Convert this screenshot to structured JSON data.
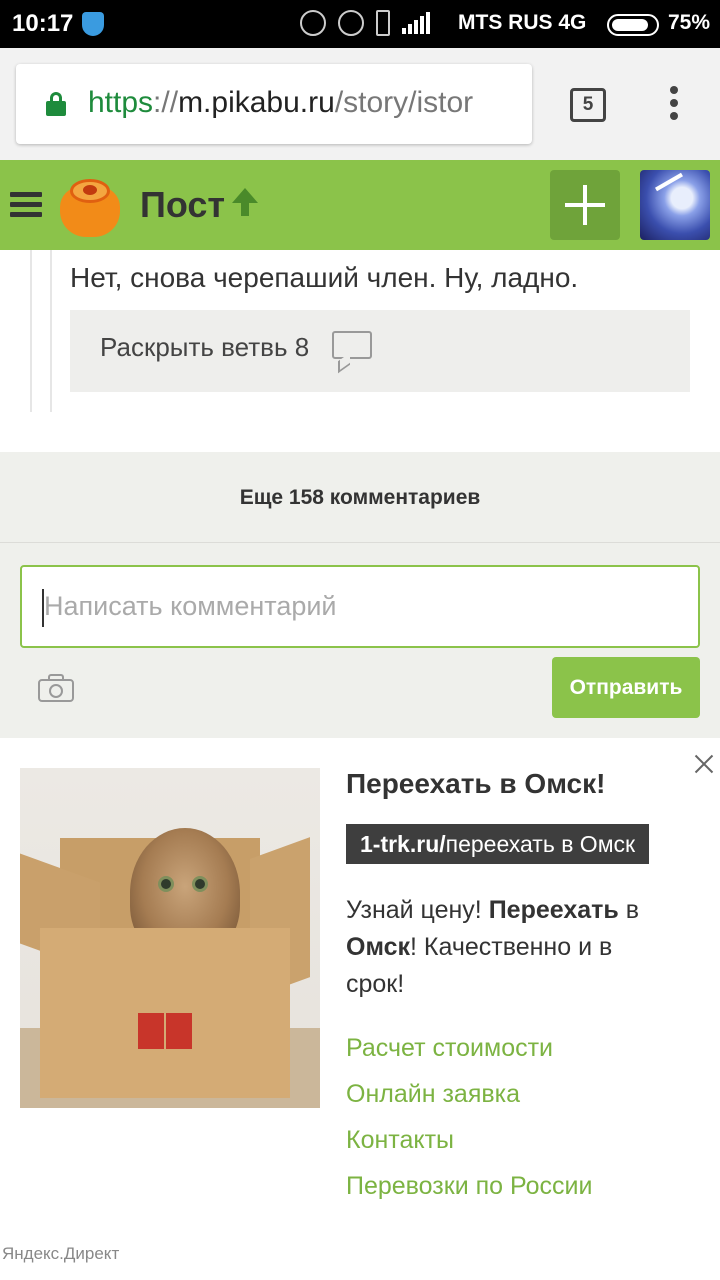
{
  "status_bar": {
    "time": "10:17",
    "carrier": "MTS RUS 4G",
    "battery": "75%"
  },
  "browser": {
    "url_scheme": "https",
    "url_sep": "://",
    "url_host": "m.pikabu.ru",
    "url_path": "/story/istor",
    "tab_count": "5"
  },
  "header": {
    "title": "Пост",
    "accent_color": "#8bc34a"
  },
  "comment": {
    "text": "Нет, снова черепаший член. Ну, ладно.",
    "expand_label": "Раскрыть ветвь 8"
  },
  "comments_footer": {
    "more_label": "Еще 158 комментариев",
    "input_placeholder": "Написать комментарий",
    "send_label": "Отправить"
  },
  "ad": {
    "title": "Переехать в Омск!",
    "domain_bold": "1-trk.ru/",
    "domain_rest": "переехать в Омск",
    "desc_1": "Узнай цену! ",
    "desc_bold_1": "Переехать",
    "desc_2": " в ",
    "desc_bold_2": "Омск",
    "desc_3": "! Качественно и в срок!",
    "links": [
      "Расчет стоимости",
      "Онлайн заявка",
      "Контакты",
      "Перевозки по России"
    ],
    "footer": "Яндекс.Директ"
  }
}
